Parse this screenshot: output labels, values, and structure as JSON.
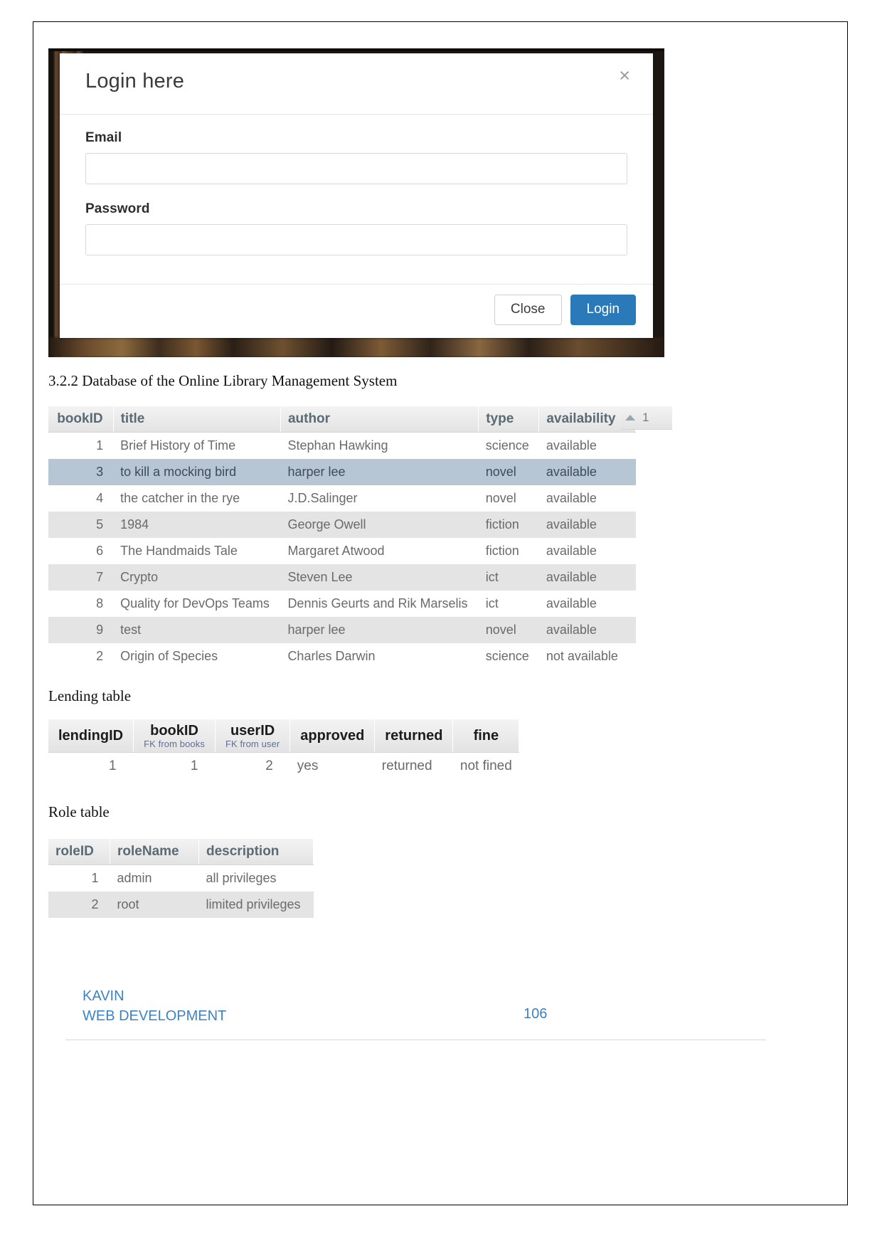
{
  "document": {
    "heading": "3.2.2 Database of the Online Library Management System",
    "lending_caption": "Lending table",
    "role_caption": "Role table"
  },
  "login_modal": {
    "title": "Login here",
    "close_icon": "×",
    "email_label": "Email",
    "email_value": "",
    "email_placeholder": "",
    "password_label": "Password",
    "password_value": "",
    "password_placeholder": "",
    "close_button": "Close",
    "login_button": "Login",
    "accent_color": "#2a7ab9"
  },
  "books_table": {
    "columns": [
      "bookID",
      "title",
      "author",
      "type",
      "availability"
    ],
    "sort": {
      "arrow_icon": "sort-ascending-icon",
      "indicator": "1"
    },
    "rows": [
      {
        "bookID": "1",
        "title": "Brief History of Time",
        "author": "Stephan Hawking",
        "type": "science",
        "availability": "available",
        "style": ""
      },
      {
        "bookID": "3",
        "title": "to kill a mocking bird",
        "author": "harper lee",
        "type": "novel",
        "availability": "available",
        "style": "sel"
      },
      {
        "bookID": "4",
        "title": "the catcher in the rye",
        "author": "J.D.Salinger",
        "type": "novel",
        "availability": "available",
        "style": ""
      },
      {
        "bookID": "5",
        "title": "1984",
        "author": "George Owell",
        "type": "fiction",
        "availability": "available",
        "style": "alt"
      },
      {
        "bookID": "6",
        "title": "The Handmaids Tale",
        "author": "Margaret Atwood",
        "type": "fiction",
        "availability": "available",
        "style": ""
      },
      {
        "bookID": "7",
        "title": "Crypto",
        "author": "Steven Lee",
        "type": "ict",
        "availability": "available",
        "style": "alt"
      },
      {
        "bookID": "8",
        "title": "Quality for DevOps Teams",
        "author": "Dennis Geurts and Rik Marselis",
        "type": "ict",
        "availability": "available",
        "style": ""
      },
      {
        "bookID": "9",
        "title": "test",
        "author": "harper lee",
        "type": "novel",
        "availability": "available",
        "style": "alt"
      },
      {
        "bookID": "2",
        "title": "Origin of Species",
        "author": "Charles Darwin",
        "type": "science",
        "availability": "not available",
        "style": ""
      }
    ]
  },
  "lending_table": {
    "columns": [
      {
        "label": "lendingID",
        "fk": ""
      },
      {
        "label": "bookID",
        "fk": "FK from books"
      },
      {
        "label": "userID",
        "fk": "FK from user"
      },
      {
        "label": "approved",
        "fk": ""
      },
      {
        "label": "returned",
        "fk": ""
      },
      {
        "label": "fine",
        "fk": ""
      }
    ],
    "rows": [
      {
        "lendingID": "1",
        "bookID": "1",
        "userID": "2",
        "approved": "yes",
        "returned": "returned",
        "fine": "not fined"
      }
    ]
  },
  "role_table": {
    "columns": [
      "roleID",
      "roleName",
      "description"
    ],
    "rows": [
      {
        "roleID": "1",
        "roleName": "admin",
        "description": "all privileges",
        "style": ""
      },
      {
        "roleID": "2",
        "roleName": "root",
        "description": "limited privileges",
        "style": "alt"
      }
    ]
  },
  "page_footer": {
    "line1": "KAVIN",
    "line2": "WEB DEVELOPMENT",
    "page_number": "106",
    "color": "#3d83c4"
  }
}
